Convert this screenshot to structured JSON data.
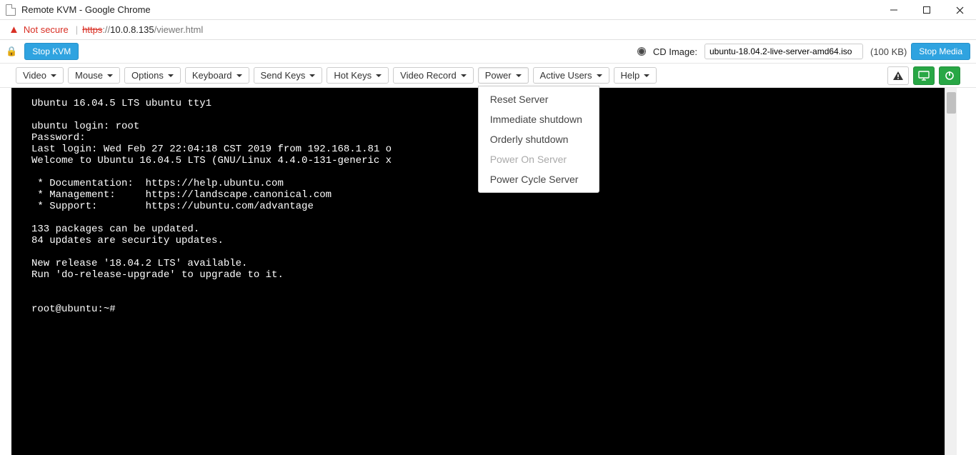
{
  "window": {
    "title": "Remote KVM - Google Chrome"
  },
  "address": {
    "not_secure": "Not secure",
    "https": "https",
    "sep": "://",
    "host": "10.0.8.135",
    "path": "/viewer.html"
  },
  "kvm_bar": {
    "stop_kvm": "Stop KVM",
    "cd_label": "CD Image:",
    "cd_file": "ubuntu-18.04.2-live-server-amd64.iso",
    "cd_size": "(100 KB)",
    "stop_media": "Stop Media"
  },
  "menus": {
    "video": "Video",
    "mouse": "Mouse",
    "options": "Options",
    "keyboard": "Keyboard",
    "send_keys": "Send Keys",
    "hot_keys": "Hot Keys",
    "video_record": "Video Record",
    "power": "Power",
    "active_users": "Active Users",
    "help": "Help"
  },
  "power_menu": {
    "items": [
      {
        "label": "Reset Server",
        "disabled": false
      },
      {
        "label": "Immediate shutdown",
        "disabled": false
      },
      {
        "label": "Orderly shutdown",
        "disabled": false
      },
      {
        "label": "Power On Server",
        "disabled": true
      },
      {
        "label": "Power Cycle Server",
        "disabled": false
      }
    ]
  },
  "terminal_text": "Ubuntu 16.04.5 LTS ubuntu tty1\n\nubuntu login: root\nPassword:\nLast login: Wed Feb 27 22:04:18 CST 2019 from 192.168.1.81 o\nWelcome to Ubuntu 16.04.5 LTS (GNU/Linux 4.4.0-131-generic x\n\n * Documentation:  https://help.ubuntu.com\n * Management:     https://landscape.canonical.com\n * Support:        https://ubuntu.com/advantage\n\n133 packages can be updated.\n84 updates are security updates.\n\nNew release '18.04.2 LTS' available.\nRun 'do-release-upgrade' to upgrade to it.\n\n\nroot@ubuntu:~#"
}
